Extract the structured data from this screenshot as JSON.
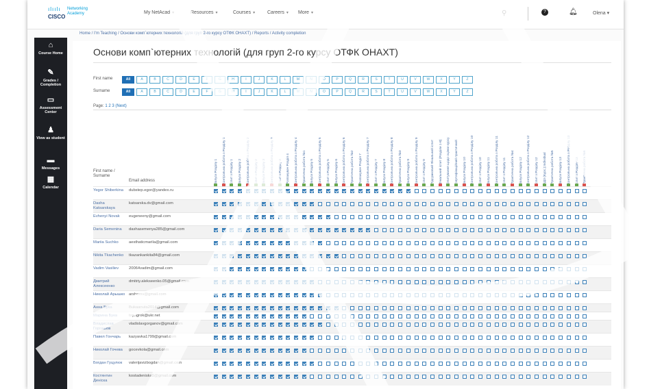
{
  "topbar": {
    "logo_brand": "CISCO",
    "logo_product": "Networking Academy",
    "nav": [
      {
        "label": "My NetAcad"
      },
      {
        "label": "Resources"
      },
      {
        "label": "Courses"
      },
      {
        "label": "Careers"
      },
      {
        "label": "More"
      }
    ],
    "user_name": "Olena"
  },
  "breadcrumb": "Home / I'm Teaching / Основи комп`ютерних технологій (для груп 2-го курсу ОТФК ОНАХТ) / Reports / Activity completion",
  "sidebar": [
    {
      "icon": "home-icon",
      "label": "Course Home"
    },
    {
      "icon": "grades-icon",
      "label": "Grades / Completion"
    },
    {
      "icon": "assessment-icon",
      "label": "Assessment Center"
    },
    {
      "icon": "view-student-icon",
      "label": "View as student"
    },
    {
      "icon": "messages-icon",
      "label": "Messages"
    },
    {
      "icon": "calendar-icon",
      "label": "Calendar"
    }
  ],
  "page_title": "Основи комп`ютерних технологій (для груп 2-го курсу ОТФК ОНАХТ)",
  "filters": {
    "first_name_label": "First name",
    "surname_label": "Surname",
    "all_label": "All",
    "letters": [
      "A",
      "B",
      "C",
      "D",
      "E",
      "F",
      "G",
      "H",
      "I",
      "J",
      "K",
      "L",
      "M",
      "N",
      "O",
      "P",
      "Q",
      "R",
      "S",
      "T",
      "U",
      "V",
      "W",
      "X",
      "Y",
      "Z"
    ]
  },
  "pager": {
    "prefix": "Page:",
    "pages": [
      "1",
      "2",
      "3"
    ],
    "next": "(Next)"
  },
  "table": {
    "name_header": "First name / Surname",
    "email_header": "Email address",
    "activities": [
      "Запуск Розділу 1",
      "Контрольна робота з Розділу 1",
      "Іспит з Розділу 1",
      "Запуск Розділу 2",
      "Контрольна робота з Розділу 2",
      "Іспит з Розділу 2",
      "Запуск Розділу 3",
      "Контрольна робота з Розділу 3",
      "Іспит з Розділу 3",
      "Розпакувач Розділ 4",
      "Контрольна робота з Розділу 4",
      "Практична робота №1",
      "Запуск Розділу 5",
      "Контрольна робота з Розділу 5",
      "Іспит з Розділу 5",
      "Запуск Розділу 6",
      "Контрольна робота з Розділу 6",
      "Практична робота №2",
      "Розпакувач Розділ 7",
      "Контрольна робота з Розділу 7",
      "Іспит з Розділу 7",
      "Запуск Розділу 8",
      "Контрольна робота з Розділу 8",
      "Практична робота №3",
      "Запуск Розділу 9",
      "Контрольна робота з Розділу 9",
      "Іспит з Розділу 9",
      "Підсумковий Фінальний іспит",
      "Фінальний іспит (Розділи 1-8)",
      "Опитування щодо оцінки курсу",
      "Сертифікаційний практичний",
      "Запуск Розділу 10",
      "Контрольна робота з Розділу 10",
      "Іспит з Розділу 10",
      "Запуск Розділу 11",
      "Контрольна робота з Розділу 11",
      "Іспит з Розділу 11",
      "Практична робота №4",
      "Запуск Розділу 12",
      "Контрольна робота з Розділу 12",
      "Іспит з Розділу 12",
      "КДЗ (Курс.);Individual",
      "Практична робота №5",
      "Запуск Розділу 13",
      "Контрольна робота з Розділу 13",
      "Іспит з Розділу 13",
      "Практична робота №6"
    ],
    "rows": [
      {
        "name": "Yegor Shiberkina",
        "email": "dubstep.egor@yandex.ru",
        "done": 25
      },
      {
        "name": "Dasha Katsarskaya",
        "email": "katsarska.dv@gmail.com",
        "done": 13
      },
      {
        "name": "Evhenyi Novak",
        "email": "eugeneeny@gmail.com",
        "done": 15
      },
      {
        "name": "Daria Semenina",
        "email": "dashasemenya285@gmail.com",
        "done": 20
      },
      {
        "name": "Mariia Suchko",
        "email": "aesthaticmarila@gmail.com",
        "done": 14
      },
      {
        "name": "Nikita Tkachenko",
        "email": "tkazankankita84@gmail.com",
        "done": 16
      },
      {
        "name": "Vadim Vasiliev",
        "email": "20064vadim@gmail.com",
        "done": 12
      },
      {
        "name": "Дмитрий Алексеенко",
        "email": "dmitriy.alekseenko.05@gmail.com",
        "done": 13
      },
      {
        "name": "Николай Арышко",
        "email": "arshemv@gmail.com",
        "done": 14
      },
      {
        "name": "Анна Бука",
        "email": "Bukaanuta2014@gmail.com",
        "done": 16
      },
      {
        "name": "Марина Бука",
        "email": "top.igrok@ukr.net",
        "done": 12
      },
      {
        "name": "Владислав Горгашов",
        "email": "vladislavgorganov@gmail.com",
        "done": 14
      },
      {
        "name": "Павел Гончарь",
        "email": "kazyavka1799@gmail.com",
        "done": 13
      },
      {
        "name": "Николай Гочева",
        "email": "gocevkola@gmail.com",
        "done": 12
      },
      {
        "name": "Богдан Гуцулюк",
        "email": "valerijavizbogdan@gmail.com",
        "done": 13
      },
      {
        "name": "Костянтин Деніска",
        "email": "kostadeniska5@gmail.com",
        "done": 12
      }
    ]
  }
}
